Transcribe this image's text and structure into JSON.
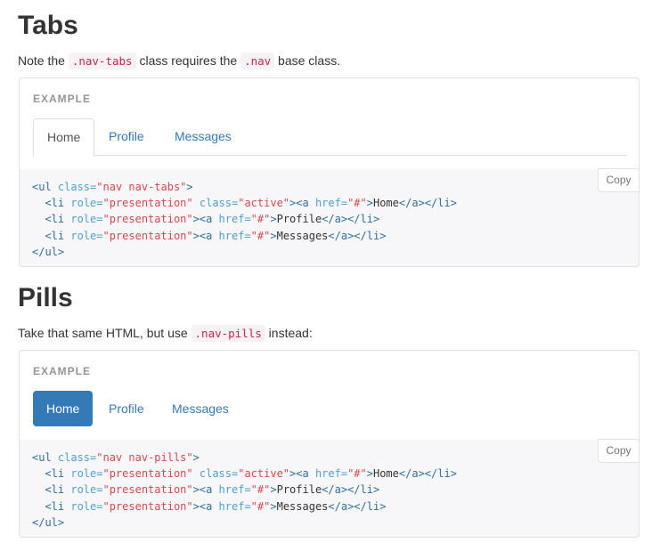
{
  "tabs_section": {
    "title": "Tabs",
    "lead": {
      "before": "Note the ",
      "code1": ".nav-tabs",
      "middle": " class requires the ",
      "code2": ".nav",
      "after": " base class."
    },
    "example_label": "EXAMPLE",
    "items": [
      "Home",
      "Profile",
      "Messages"
    ],
    "active_index": 0,
    "copy_label": "Copy",
    "code_lines": [
      [
        [
          "tg",
          "<ul "
        ],
        [
          "at",
          "class="
        ],
        [
          "st",
          "\"nav nav-tabs\""
        ],
        [
          "tg",
          ">"
        ]
      ],
      [
        [
          "tx",
          "  "
        ],
        [
          "tg",
          "<li "
        ],
        [
          "at",
          "role="
        ],
        [
          "st",
          "\"presentation\""
        ],
        [
          "tx",
          " "
        ],
        [
          "at",
          "class="
        ],
        [
          "st",
          "\"active\""
        ],
        [
          "tg",
          "><a "
        ],
        [
          "at",
          "href="
        ],
        [
          "st",
          "\"#\""
        ],
        [
          "tg",
          ">"
        ],
        [
          "tx",
          "Home"
        ],
        [
          "tg",
          "</a></li>"
        ]
      ],
      [
        [
          "tx",
          "  "
        ],
        [
          "tg",
          "<li "
        ],
        [
          "at",
          "role="
        ],
        [
          "st",
          "\"presentation\""
        ],
        [
          "tg",
          "><a "
        ],
        [
          "at",
          "href="
        ],
        [
          "st",
          "\"#\""
        ],
        [
          "tg",
          ">"
        ],
        [
          "tx",
          "Profile"
        ],
        [
          "tg",
          "</a></li>"
        ]
      ],
      [
        [
          "tx",
          "  "
        ],
        [
          "tg",
          "<li "
        ],
        [
          "at",
          "role="
        ],
        [
          "st",
          "\"presentation\""
        ],
        [
          "tg",
          "><a "
        ],
        [
          "at",
          "href="
        ],
        [
          "st",
          "\"#\""
        ],
        [
          "tg",
          ">"
        ],
        [
          "tx",
          "Messages"
        ],
        [
          "tg",
          "</a></li>"
        ]
      ],
      [
        [
          "tg",
          "</ul>"
        ]
      ]
    ]
  },
  "pills_section": {
    "title": "Pills",
    "lead": {
      "before": "Take that same HTML, but use ",
      "code1": ".nav-pills",
      "after": " instead:"
    },
    "example_label": "EXAMPLE",
    "items": [
      "Home",
      "Profile",
      "Messages"
    ],
    "active_index": 0,
    "copy_label": "Copy",
    "code_lines": [
      [
        [
          "tg",
          "<ul "
        ],
        [
          "at",
          "class="
        ],
        [
          "st",
          "\"nav nav-pills\""
        ],
        [
          "tg",
          ">"
        ]
      ],
      [
        [
          "tx",
          "  "
        ],
        [
          "tg",
          "<li "
        ],
        [
          "at",
          "role="
        ],
        [
          "st",
          "\"presentation\""
        ],
        [
          "tx",
          " "
        ],
        [
          "at",
          "class="
        ],
        [
          "st",
          "\"active\""
        ],
        [
          "tg",
          "><a "
        ],
        [
          "at",
          "href="
        ],
        [
          "st",
          "\"#\""
        ],
        [
          "tg",
          ">"
        ],
        [
          "tx",
          "Home"
        ],
        [
          "tg",
          "</a></li>"
        ]
      ],
      [
        [
          "tx",
          "  "
        ],
        [
          "tg",
          "<li "
        ],
        [
          "at",
          "role="
        ],
        [
          "st",
          "\"presentation\""
        ],
        [
          "tg",
          "><a "
        ],
        [
          "at",
          "href="
        ],
        [
          "st",
          "\"#\""
        ],
        [
          "tg",
          ">"
        ],
        [
          "tx",
          "Profile"
        ],
        [
          "tg",
          "</a></li>"
        ]
      ],
      [
        [
          "tx",
          "  "
        ],
        [
          "tg",
          "<li "
        ],
        [
          "at",
          "role="
        ],
        [
          "st",
          "\"presentation\""
        ],
        [
          "tg",
          "><a "
        ],
        [
          "at",
          "href="
        ],
        [
          "st",
          "\"#\""
        ],
        [
          "tg",
          ">"
        ],
        [
          "tx",
          "Messages"
        ],
        [
          "tg",
          "</a></li>"
        ]
      ],
      [
        [
          "tg",
          "</ul>"
        ]
      ]
    ]
  },
  "colors": {
    "link": "#337ab7",
    "active_pill_bg": "#337ab7",
    "code_inline_fg": "#c7254e",
    "code_inline_bg": "#f9f2f4",
    "code_block_bg": "#f7f7f9"
  }
}
